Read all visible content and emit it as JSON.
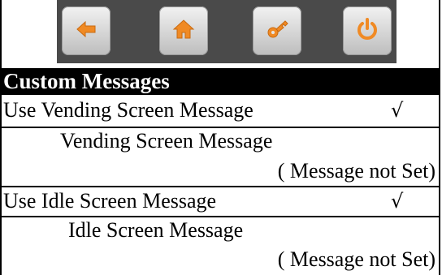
{
  "toolbar": {
    "buttons": [
      {
        "name": "back",
        "icon": "left-arrow-icon"
      },
      {
        "name": "home",
        "icon": "house-icon"
      },
      {
        "name": "key",
        "icon": "key-icon"
      },
      {
        "name": "power",
        "icon": "power-icon"
      }
    ],
    "accent": "#f08a24"
  },
  "section": {
    "title": "Custom Messages"
  },
  "vending": {
    "toggle_label": "Use Vending Screen Message",
    "toggle_mark": "√",
    "message_label": "Vending Screen Message",
    "message_value": "( Message not Set)"
  },
  "idle": {
    "toggle_label": "Use Idle Screen Message",
    "toggle_mark": "√",
    "message_label": "Idle Screen Message",
    "message_value": "( Message not Set)"
  }
}
